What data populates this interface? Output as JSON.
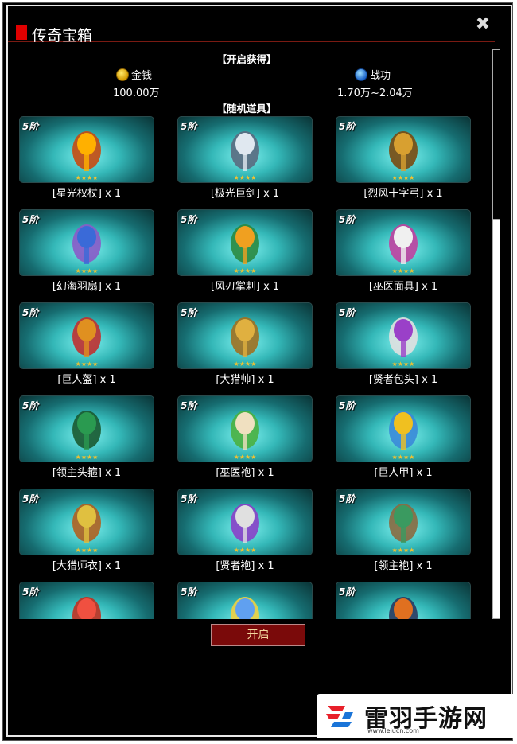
{
  "window": {
    "title": "传奇宝箱",
    "close_icon": "close-icon"
  },
  "sections": {
    "open_rewards": "【开启获得】",
    "random_items": "【随机道具】"
  },
  "rewards": [
    {
      "icon": "gold-coin-icon",
      "label": "金钱",
      "value": "100.00万"
    },
    {
      "icon": "merit-medal-icon",
      "label": "战功",
      "value": "1.70万~2.04万"
    }
  ],
  "items": [
    {
      "tier": "5阶",
      "stars": "★★★★",
      "name": "[星光权杖] x 1",
      "icon": "scepter-icon"
    },
    {
      "tier": "5阶",
      "stars": "★★★★",
      "name": "[极光巨剑] x 1",
      "icon": "greatsword-icon"
    },
    {
      "tier": "5阶",
      "stars": "★★★★",
      "name": "[烈风十字弓] x 1",
      "icon": "crossbow-icon"
    },
    {
      "tier": "5阶",
      "stars": "★★★★",
      "name": "[幻海羽扇] x 1",
      "icon": "feather-fan-icon"
    },
    {
      "tier": "5阶",
      "stars": "★★★★",
      "name": "[风刃掌刺] x 1",
      "icon": "claw-blade-icon"
    },
    {
      "tier": "5阶",
      "stars": "★★★★",
      "name": "[巫医面具] x 1",
      "icon": "shaman-mask-icon"
    },
    {
      "tier": "5阶",
      "stars": "★★★★",
      "name": "[巨人盔] x 1",
      "icon": "giant-helmet-icon"
    },
    {
      "tier": "5阶",
      "stars": "★★★★",
      "name": "[大猎帅] x 1",
      "icon": "hunter-helmet-icon"
    },
    {
      "tier": "5阶",
      "stars": "★★★★",
      "name": "[贤者包头] x 1",
      "icon": "sage-turban-icon"
    },
    {
      "tier": "5阶",
      "stars": "★★★★",
      "name": "[领主头箍] x 1",
      "icon": "lord-circlet-icon"
    },
    {
      "tier": "5阶",
      "stars": "★★★★",
      "name": "[巫医袍] x 1",
      "icon": "shaman-robe-icon"
    },
    {
      "tier": "5阶",
      "stars": "★★★★",
      "name": "[巨人甲] x 1",
      "icon": "giant-armor-icon"
    },
    {
      "tier": "5阶",
      "stars": "★★★★",
      "name": "[大猎师衣] x 1",
      "icon": "hunter-coat-icon"
    },
    {
      "tier": "5阶",
      "stars": "★★★★",
      "name": "[贤者袍] x 1",
      "icon": "sage-robe-icon"
    },
    {
      "tier": "5阶",
      "stars": "★★★★",
      "name": "[领主袍] x 1",
      "icon": "lord-robe-icon"
    },
    {
      "tier": "5阶",
      "stars": "",
      "name": "",
      "icon": "necklace-icon"
    },
    {
      "tier": "5阶",
      "stars": "",
      "name": "",
      "icon": "blue-flower-icon"
    },
    {
      "tier": "5阶",
      "stars": "",
      "name": "",
      "icon": "banner-icon"
    }
  ],
  "open_button": "开启",
  "watermark": {
    "name": "雷羽手游网",
    "url": "www.leiucn.com",
    "logo_icon": "leiyu-logo-icon"
  },
  "colors": {
    "accent_red": "#e00000",
    "button_bg": "#7a0a0a",
    "star_gold": "#f2c230",
    "card_teal": "#34b8b8"
  }
}
